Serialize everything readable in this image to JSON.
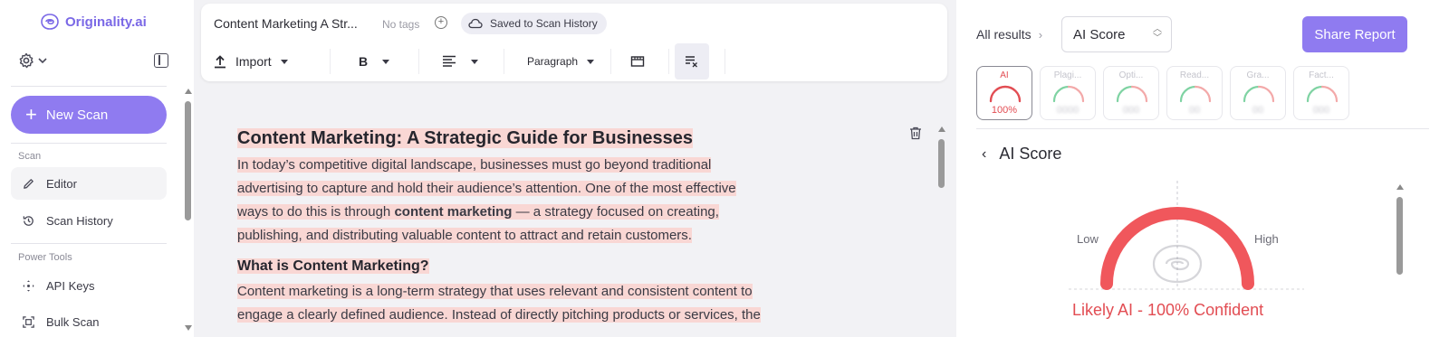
{
  "app": {
    "brand": "Originality.ai"
  },
  "sidebar": {
    "new_scan_label": "New Scan",
    "sections": {
      "scan": "Scan",
      "power_tools": "Power Tools"
    },
    "items": [
      {
        "label": "Editor",
        "icon": "pencil-icon",
        "active": true
      },
      {
        "label": "Scan History",
        "icon": "history-icon",
        "active": false
      },
      {
        "label": "API Keys",
        "icon": "api-keys-icon",
        "active": false
      },
      {
        "label": "Bulk Scan",
        "icon": "bulk-scan-icon",
        "active": false
      }
    ]
  },
  "editor": {
    "doc_title": "Content Marketing A Str...",
    "no_tags": "No tags",
    "saved_status": "Saved to Scan History",
    "toolbar": {
      "import_label": "Import",
      "bold_label": "B",
      "paragraph_label": "Paragraph"
    },
    "content": {
      "heading": "Content Marketing: A Strategic Guide for Businesses",
      "p1_lines": [
        "In today’s competitive digital landscape, businesses must go beyond traditional",
        "advertising to capture and hold their audience’s attention. One of the most effective"
      ],
      "p1_line3_pre": "ways to do this is through ",
      "p1_line3_bold": "content marketing",
      "p1_line3_post": " — a strategy focused on creating,",
      "p1_line4": "publishing, and distributing valuable content to attract and retain customers.",
      "subheading": "What is Content Marketing?",
      "p2_lines": [
        "Content marketing is a long-term strategy that uses relevant and consistent content to",
        "engage a clearly defined audience. Instead of directly pitching products or services, the"
      ]
    }
  },
  "results": {
    "breadcrumb": "All results",
    "selected_score": "AI Score",
    "share_label": "Share Report",
    "tiles": [
      {
        "label": "AI",
        "value": "100%",
        "active": true,
        "color": "#e24d53",
        "level": 1.0
      },
      {
        "label": "Plagi...",
        "value": "0000",
        "active": false,
        "color": "#f3a9a9",
        "level": 0.5
      },
      {
        "label": "Opti...",
        "value": "000",
        "active": false,
        "color": "#f3a9a9",
        "level": 0.5
      },
      {
        "label": "Read...",
        "value": "00",
        "active": false,
        "color": "#f3a9a9",
        "level": 0.5
      },
      {
        "label": "Gra...",
        "value": "00",
        "active": false,
        "color": "#f3a9a9",
        "level": 0.5
      },
      {
        "label": "Fact...",
        "value": "000",
        "active": false,
        "color": "#f3a9a9",
        "level": 0.5
      }
    ],
    "score_title": "AI Score",
    "gauge": {
      "low": "Low",
      "high": "High",
      "level": 1.0,
      "color": "#f0575c"
    },
    "verdict": "Likely AI - 100% Confident"
  },
  "colors": {
    "accent": "#8f7bf0",
    "ai_red": "#e24d53",
    "highlight": "#f9d7d4"
  }
}
